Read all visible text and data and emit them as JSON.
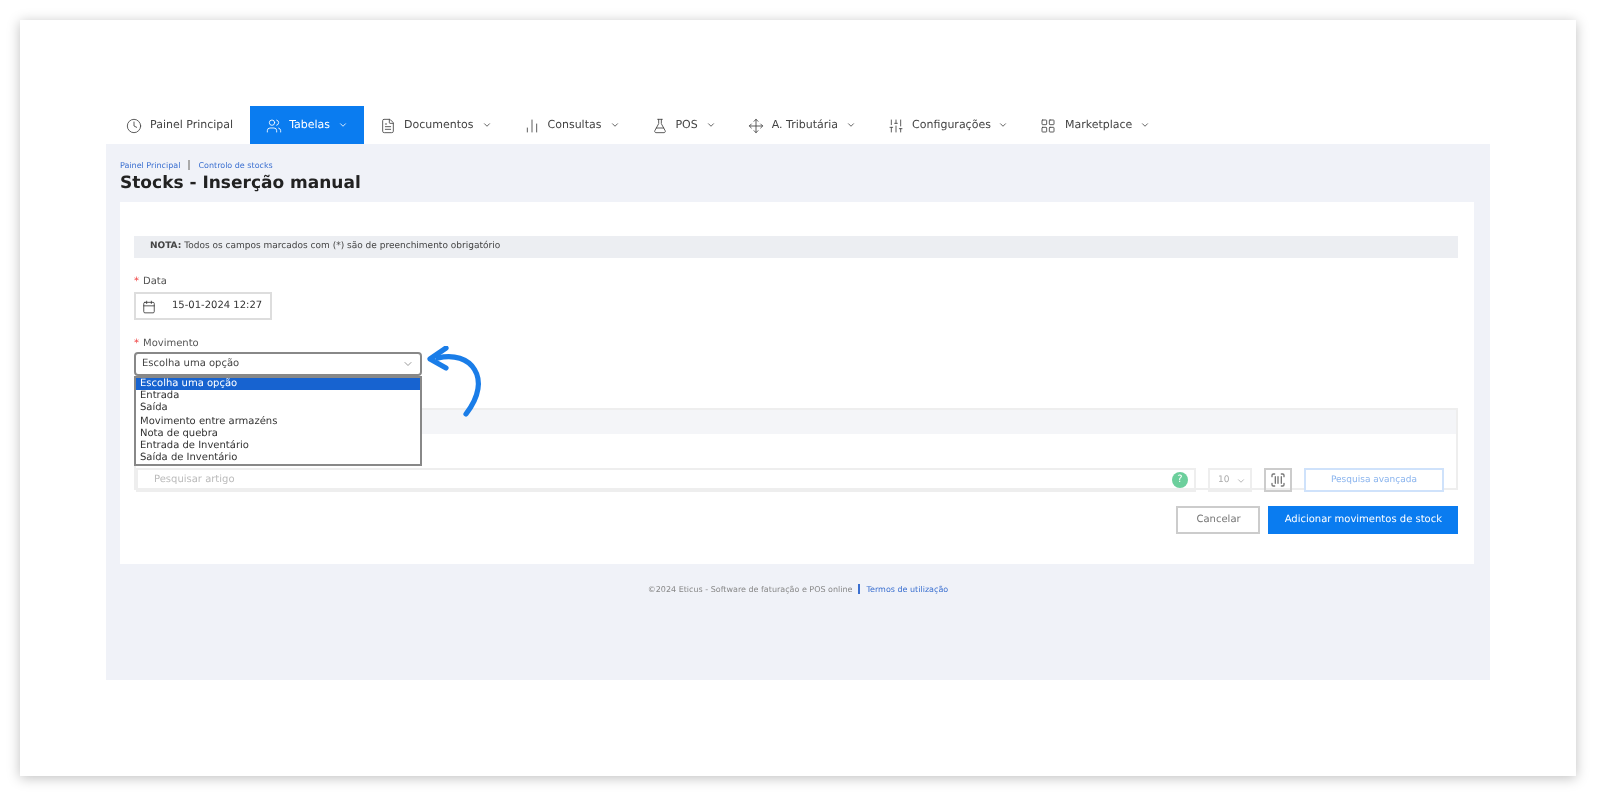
{
  "nav": [
    {
      "label": "Painel Principal",
      "dropdown": false,
      "selected": false
    },
    {
      "label": "Tabelas",
      "dropdown": true,
      "selected": true
    },
    {
      "label": "Documentos",
      "dropdown": true,
      "selected": false
    },
    {
      "label": "Consultas",
      "dropdown": true,
      "selected": false
    },
    {
      "label": "POS",
      "dropdown": true,
      "selected": false
    },
    {
      "label": "A. Tributária",
      "dropdown": true,
      "selected": false
    },
    {
      "label": "Configurações",
      "dropdown": true,
      "selected": false
    },
    {
      "label": "Marketplace",
      "dropdown": true,
      "selected": false
    }
  ],
  "breadcrumb": [
    "Painel Principal",
    "Controlo de stocks"
  ],
  "title": "Stocks - Inserção manual",
  "note": "**NOTA:** Todos os campos marcados com (*) são de preenchimento obrigatório",
  "date_field": {
    "required_mark": "*",
    "label": "Data",
    "value": "15-01-2024 12:27"
  },
  "movement_field": {
    "required_mark": "*",
    "label": "Movimento",
    "value": "Escolha uma opção",
    "expanded": true,
    "options": [
      {
        "label": "Escolha uma opção",
        "selected": true
      },
      {
        "label": "Entrada",
        "selected": false
      },
      {
        "label": "Saída",
        "selected": false
      },
      {
        "label": "Movimento entre armazéns",
        "selected": false
      },
      {
        "label": "Nota de quebra",
        "selected": false
      },
      {
        "label": "Entrada de Inventário",
        "selected": false
      },
      {
        "label": "Saída de Inventário",
        "selected": false
      }
    ]
  },
  "search": {
    "placeholder": "Pesquisar artigo",
    "help": "?",
    "page_size": "10",
    "advanced": "Pesquisa avançada"
  },
  "buttons": [
    {
      "label": "Cancelar",
      "kind": "secondary"
    },
    {
      "label": "Adicionar movimentos de stock",
      "kind": "primary"
    }
  ],
  "footer": {
    "text": "©2024 Eticus - Software de faturação e POS online",
    "link": "Termos de utilização"
  }
}
